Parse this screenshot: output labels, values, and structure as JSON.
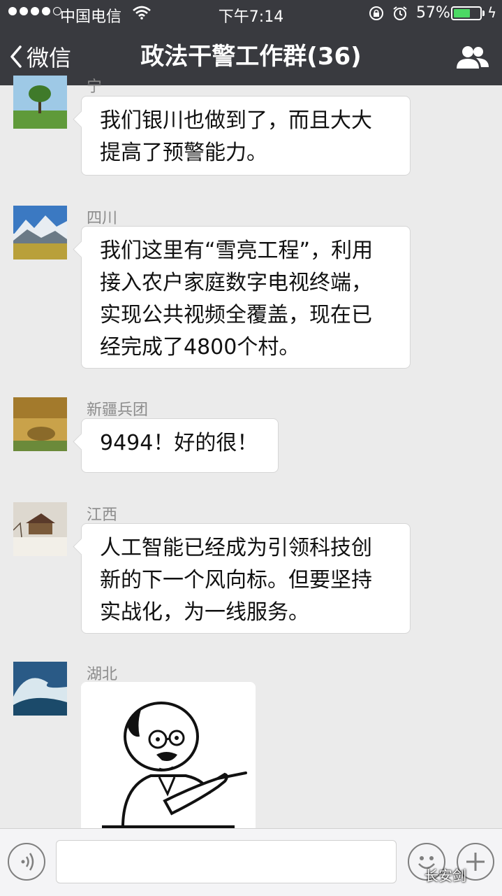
{
  "status_bar": {
    "carrier": "中国电信",
    "time": "下午7:14",
    "battery_percent": "57%",
    "battery_level": 0.57,
    "signal_bars_filled": 4,
    "signal_bars_total": 5
  },
  "nav": {
    "back_label": "微信",
    "title": "政法干警工作群(36)"
  },
  "messages": [
    {
      "sender": "宁夏",
      "text": "我们银川也做到了，而且大大\n提高了预警能力。"
    },
    {
      "sender": "四川",
      "text": "我们这里有“雪亮工程”，利用\n接入农户家庭数字电视终端，\n实现公共视频全覆盖，现在已\n经完成了4800个村。"
    },
    {
      "sender": "新疆兵团",
      "text": "9494！好的很！"
    },
    {
      "sender": "江西",
      "text": "人工智能已经成为引领科技创\n新的下一个风向标。但要坚持\n实战化，为一线服务。"
    },
    {
      "sender": "湖北",
      "text": "",
      "image": "meme-sticker"
    }
  ],
  "input": {
    "value": "",
    "placeholder": ""
  },
  "watermark": "长安剑",
  "colors": {
    "nav_bg": "#393a3f",
    "chat_bg": "#ebebeb",
    "battery": "#4cd964"
  }
}
